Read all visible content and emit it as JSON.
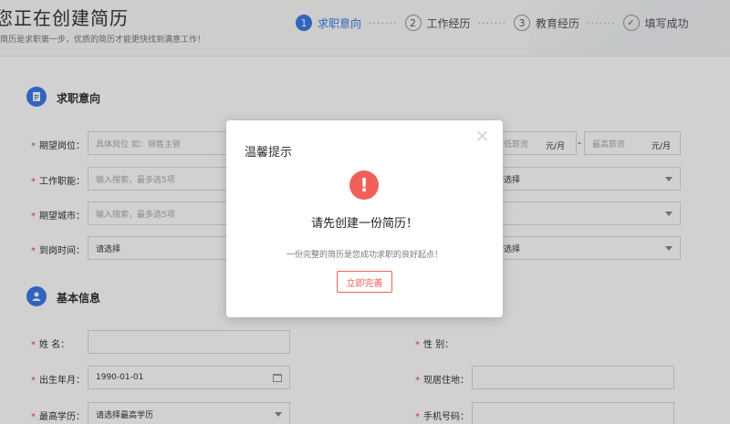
{
  "header": {
    "title": "您正在创建简历",
    "subtitle": "简历是求职第一步，优质的简历才能更快找到满意工作！",
    "steps": [
      {
        "num": "1",
        "label": "求职意向"
      },
      {
        "num": "2",
        "label": "工作经历"
      },
      {
        "num": "3",
        "label": "教育经历"
      },
      {
        "num": "",
        "label": "填写成功"
      }
    ],
    "dots": "·······"
  },
  "job_intent": {
    "title": "求职意向",
    "position_label": "期望岗位：",
    "position_placeholder": "具体岗位 如：销售主管",
    "function_label": "工作职能：",
    "function_placeholder": "输入搜索，最多选5项",
    "city_label": "期望城市：",
    "city_placeholder": "输入搜索，最多选5项",
    "arrival_label": "到岗时间：",
    "arrival_value": "请选择",
    "salary_min_placeholder": "最低薪资",
    "salary_unit": "元/月",
    "salary_dash": "-",
    "salary_max_placeholder": "最高薪资",
    "right_select_1": "请选择",
    "right_select_3": "请选择"
  },
  "basic_info": {
    "title": "基本信息",
    "name_label": "姓    名：",
    "gender_label": "性    别：",
    "birth_label": "出生年月：",
    "birth_value": "1990-01-01",
    "residence_label": "现居住地：",
    "education_label": "最高学历：",
    "education_value": "请选择最高学历",
    "phone_label": "手机号码："
  },
  "required_mark": "*",
  "modal": {
    "title": "温馨提示",
    "icon": "!",
    "message": "请先创建一份简历！",
    "tip": "一份完整的简历是您成功求职的良好起点！",
    "button": "立即完善"
  },
  "colors": {
    "accent": "#3d7be8",
    "danger": "#f0605a"
  }
}
